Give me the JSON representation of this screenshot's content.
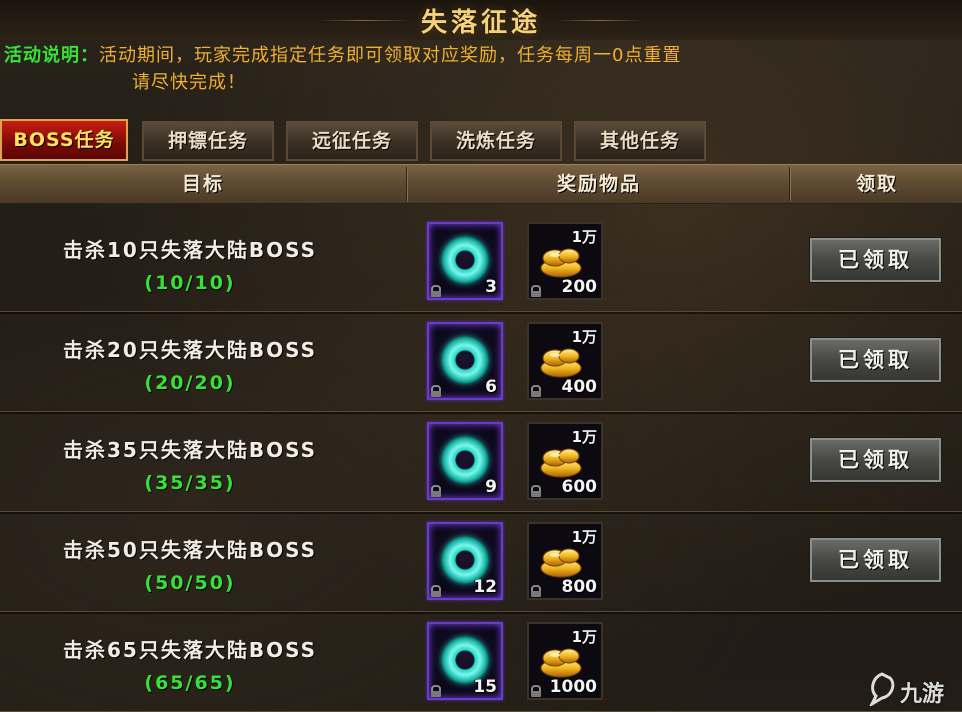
{
  "title": "失落征途",
  "description": {
    "label": "活动说明：",
    "line1": "活动期间，玩家完成指定任务即可领取对应奖励，任务每周一0点重置",
    "line2": "请尽快完成！"
  },
  "tabs": [
    {
      "label": "BOSS任务",
      "active": true
    },
    {
      "label": "押镖任务",
      "active": false
    },
    {
      "label": "远征任务",
      "active": false
    },
    {
      "label": "洗炼任务",
      "active": false
    },
    {
      "label": "其他任务",
      "active": false
    }
  ],
  "columns": {
    "target": "目标",
    "rewards": "奖励物品",
    "claim": "领取"
  },
  "rows": [
    {
      "task": "击杀10只失落大陆BOSS",
      "progress": "(10/10)",
      "jade_qty": "3",
      "gold_unit": "1万",
      "gold_qty": "200",
      "claim_label": "已领取"
    },
    {
      "task": "击杀20只失落大陆BOSS",
      "progress": "(20/20)",
      "jade_qty": "6",
      "gold_unit": "1万",
      "gold_qty": "400",
      "claim_label": "已领取"
    },
    {
      "task": "击杀35只失落大陆BOSS",
      "progress": "(35/35)",
      "jade_qty": "9",
      "gold_unit": "1万",
      "gold_qty": "600",
      "claim_label": "已领取"
    },
    {
      "task": "击杀50只失落大陆BOSS",
      "progress": "(50/50)",
      "jade_qty": "12",
      "gold_unit": "1万",
      "gold_qty": "800",
      "claim_label": "已领取"
    },
    {
      "task": "击杀65只失落大陆BOSS",
      "progress": "(65/65)",
      "jade_qty": "15",
      "gold_unit": "1万",
      "gold_qty": "1000",
      "claim_label": ""
    }
  ],
  "icons": {
    "jade": "jade-ring-icon",
    "gold": "gold-ingot-icon",
    "lock": "lock-icon"
  },
  "watermark": "九游",
  "colors": {
    "title": "#f4d27a",
    "label_green": "#38e038",
    "desc_orange": "#f0b030",
    "active_tab": "#c81e14",
    "progress_green": "#38e038"
  }
}
